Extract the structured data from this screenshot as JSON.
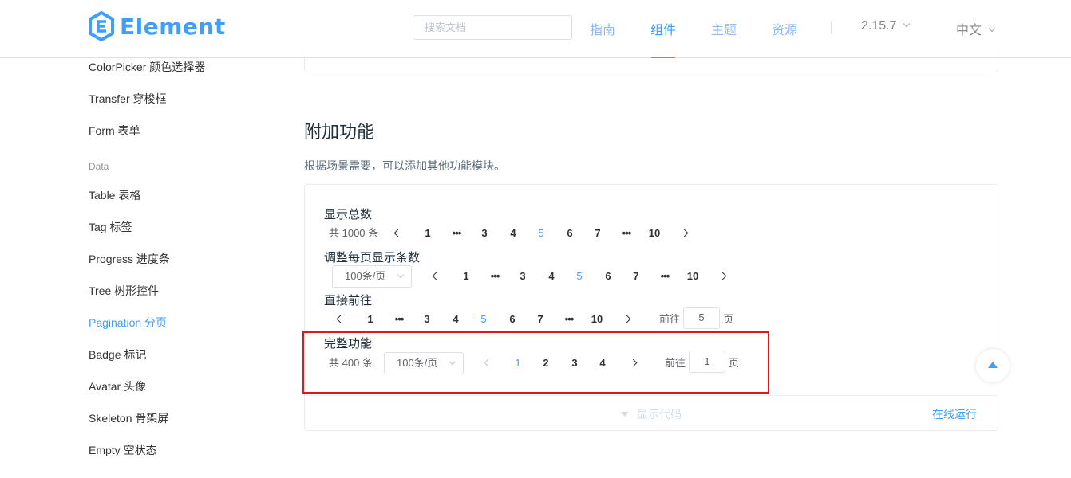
{
  "header": {
    "logo_text": "Element",
    "search_placeholder": "搜索文档",
    "nav": [
      "指南",
      "组件",
      "主题",
      "资源"
    ],
    "active_nav": "组件",
    "version": "2.15.7",
    "language": "中文"
  },
  "sidebar": {
    "items": [
      {
        "label": "ColorPicker 颜色选择器"
      },
      {
        "label": "Transfer 穿梭框"
      },
      {
        "label": "Form 表单"
      },
      {
        "group": "Data"
      },
      {
        "label": "Table 表格"
      },
      {
        "label": "Tag 标签"
      },
      {
        "label": "Progress 进度条"
      },
      {
        "label": "Tree 树形控件"
      },
      {
        "label": "Pagination 分页",
        "active": true
      },
      {
        "label": "Badge 标记"
      },
      {
        "label": "Avatar 头像"
      },
      {
        "label": "Skeleton 骨架屏"
      },
      {
        "label": "Empty 空状态"
      }
    ]
  },
  "section": {
    "title": "附加功能",
    "desc": "根据场景需要，可以添加其他功能模块。"
  },
  "demos": {
    "total": {
      "title": "显示总数",
      "total_text": "共 1000 条",
      "pages": [
        "1",
        "•••",
        "3",
        "4",
        "5",
        "6",
        "7",
        "•••",
        "10"
      ],
      "current": "5"
    },
    "sizes": {
      "title": "调整每页显示条数",
      "size_value": "100条/页",
      "pages": [
        "1",
        "•••",
        "3",
        "4",
        "5",
        "6",
        "7",
        "•••",
        "10"
      ],
      "current": "5"
    },
    "jumper": {
      "title": "直接前往",
      "pages": [
        "1",
        "•••",
        "3",
        "4",
        "5",
        "6",
        "7",
        "•••",
        "10"
      ],
      "current": "5",
      "goto_label": "前往",
      "goto_value": "5",
      "goto_suffix": "页"
    },
    "full": {
      "title": "完整功能",
      "total_text": "共 400 条",
      "size_value": "100条/页",
      "pages": [
        "1",
        "2",
        "3",
        "4"
      ],
      "current": "1",
      "goto_label": "前往",
      "goto_value": "1",
      "goto_suffix": "页"
    }
  },
  "footer": {
    "show_code": "显示代码",
    "run_online": "在线运行"
  },
  "colors": {
    "accent": "#409eff",
    "highlight_border": "#e0161c"
  }
}
